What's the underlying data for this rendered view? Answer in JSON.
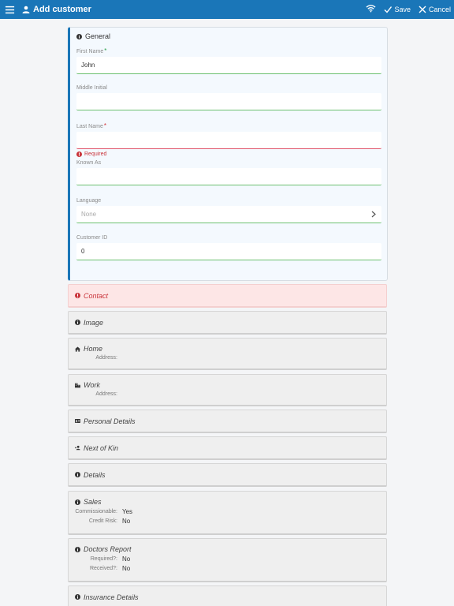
{
  "appbar": {
    "title": "Add customer",
    "save_label": "Save",
    "cancel_label": "Cancel"
  },
  "general": {
    "title": "General",
    "fields": {
      "first_name": {
        "label": "First Name",
        "value": "John"
      },
      "middle_initial": {
        "label": "Middle Initial",
        "value": ""
      },
      "last_name": {
        "label": "Last Name",
        "value": "",
        "error": "Required"
      },
      "known_as": {
        "label": "Known As",
        "value": ""
      },
      "language": {
        "label": "Language",
        "placeholder": "None"
      },
      "customer_id": {
        "label": "Customer ID",
        "value": "0"
      }
    },
    "required_mark": "*"
  },
  "sections": {
    "contact": {
      "title": "Contact"
    },
    "image": {
      "title": "Image"
    },
    "home": {
      "title": "Home",
      "address_label": "Address:"
    },
    "work": {
      "title": "Work",
      "address_label": "Address:"
    },
    "personal": {
      "title": "Personal Details"
    },
    "kin": {
      "title": "Next of Kin"
    },
    "details": {
      "title": "Details"
    },
    "sales": {
      "title": "Sales",
      "commissionable_label": "Commissionable:",
      "commissionable_value": "Yes",
      "credit_risk_label": "Credit Risk:",
      "credit_risk_value": "No"
    },
    "doctors": {
      "title": "Doctors Report",
      "required_label": "Required?:",
      "required_value": "No",
      "received_label": "Received?:",
      "received_value": "No"
    },
    "insurance": {
      "title": "Insurance Details"
    }
  },
  "colors": {
    "appbar": "#1a76b8",
    "error": "#c9333a",
    "valid": "#6cc070"
  }
}
